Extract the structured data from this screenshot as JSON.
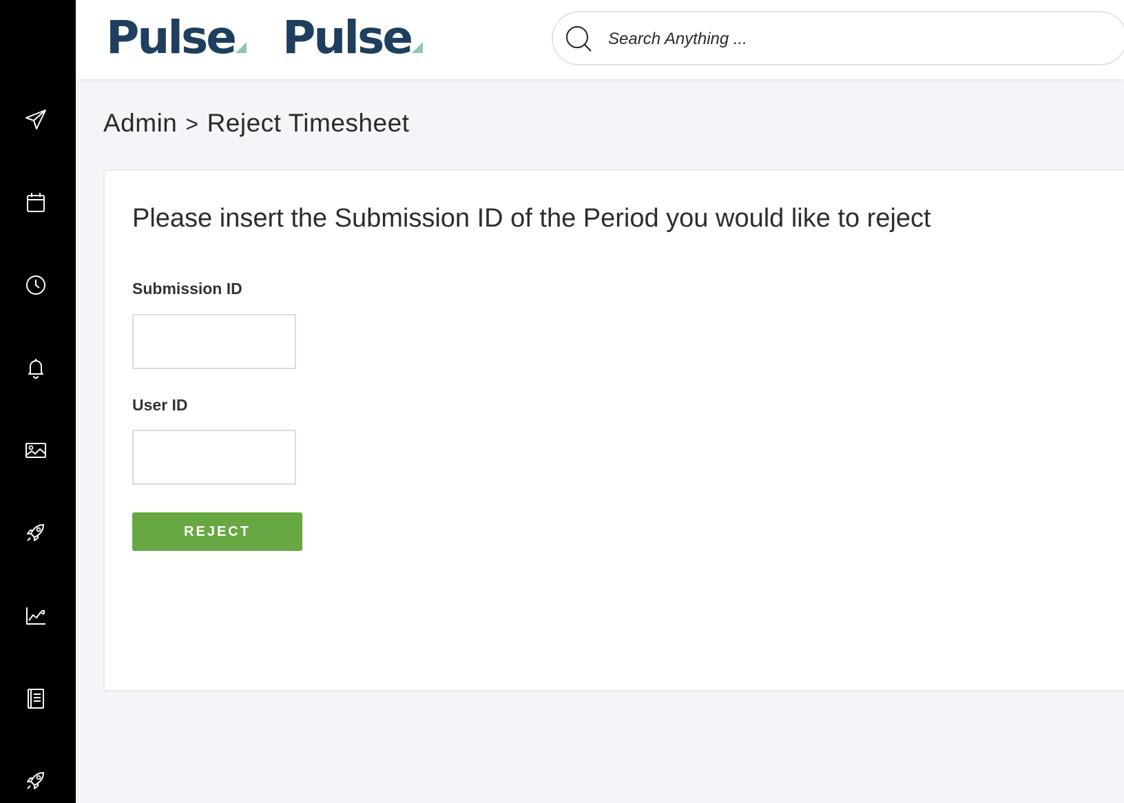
{
  "header": {
    "logo_primary": "Pulse",
    "logo_secondary": "Pulse",
    "brand_color": "#1f3f5f",
    "brand_accent": "#8fc6b3",
    "search": {
      "placeholder": "Search Anything ...",
      "value": ""
    }
  },
  "sidebar": {
    "background": "#000000",
    "items": [
      {
        "icon": "paper-plane-icon"
      },
      {
        "icon": "calendar-icon"
      },
      {
        "icon": "clock-icon"
      },
      {
        "icon": "bell-icon"
      },
      {
        "icon": "image-icon"
      },
      {
        "icon": "rocket-icon"
      },
      {
        "icon": "chart-icon"
      },
      {
        "icon": "book-icon"
      },
      {
        "icon": "rocket-icon"
      }
    ]
  },
  "breadcrumb": {
    "root": "Admin",
    "separator": ">",
    "current": "Reject Timesheet"
  },
  "form": {
    "title": "Please insert the Submission ID of the Period you would like to reject",
    "submission_label": "Submission ID",
    "submission_value": "",
    "user_label": "User ID",
    "user_value": "",
    "button_label": "REJECT",
    "button_color": "#68a843"
  }
}
